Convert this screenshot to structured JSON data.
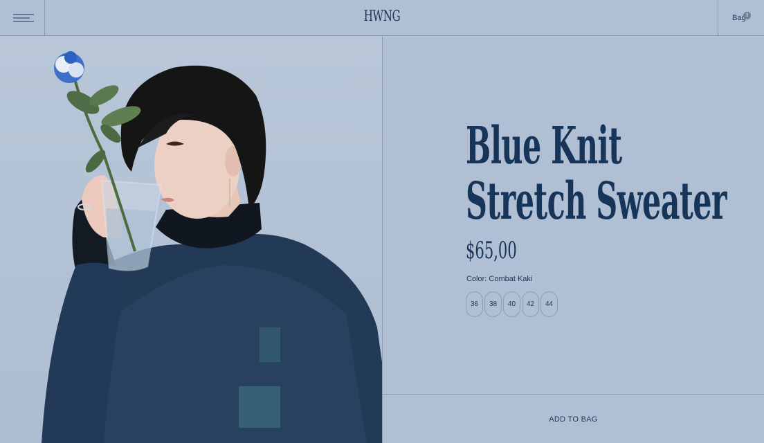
{
  "header": {
    "logo": "HWNG",
    "bag_label": "Bag",
    "bag_count": "3"
  },
  "product": {
    "title_line1": "Blue Knit",
    "title_line2": "Stretch Sweater",
    "price": "$65,00",
    "color_label": "Color: Combat Kaki",
    "sizes": [
      "36",
      "38",
      "40",
      "42",
      "44"
    ],
    "add_to_bag": "ADD TO BAG"
  },
  "colors": {
    "background": "#b0bfd4",
    "text": "#173559",
    "border": "#8697ae"
  },
  "icons": {
    "menu": "menu-icon"
  }
}
